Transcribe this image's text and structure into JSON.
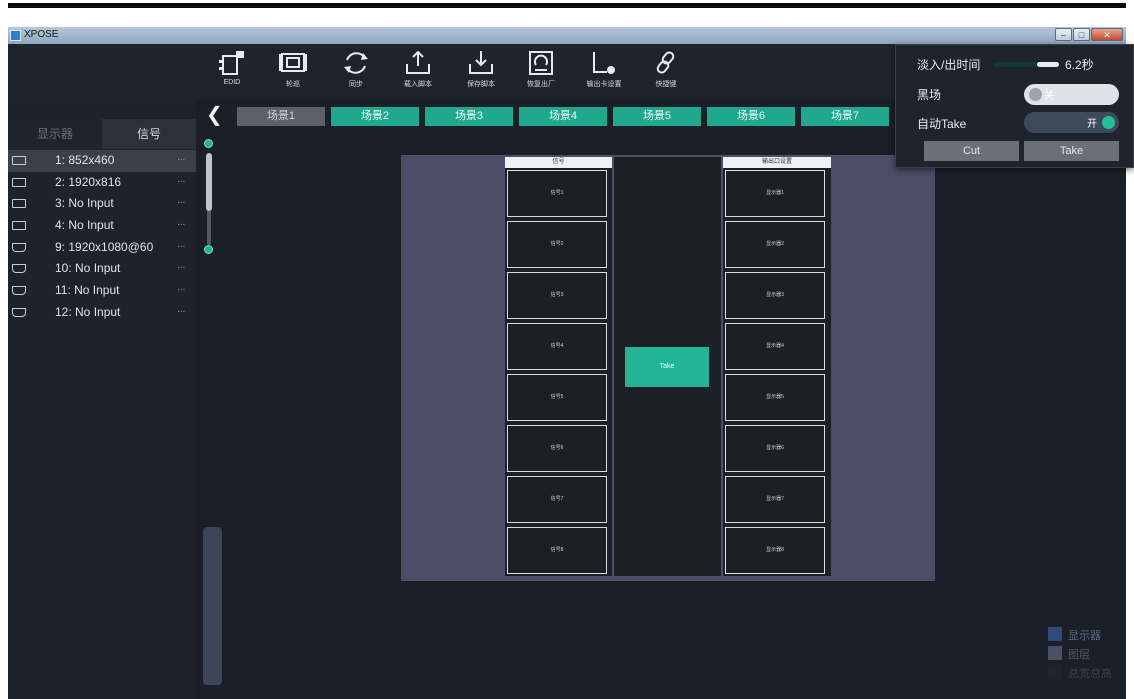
{
  "window": {
    "title": "XPOSE"
  },
  "left_panel": {
    "tabs": [
      {
        "label": "显示器"
      },
      {
        "label": "信号"
      }
    ],
    "signals": [
      {
        "label": "1: 852x460",
        "more": "...",
        "port": "dvi"
      },
      {
        "label": "2: 1920x816",
        "more": "...",
        "port": "dvi"
      },
      {
        "label": "3: No Input",
        "more": "...",
        "port": "dvi"
      },
      {
        "label": "4: No Input",
        "more": "...",
        "port": "dvi"
      },
      {
        "label": "9: 1920x1080@60",
        "more": "...",
        "port": "hdmi"
      },
      {
        "label": "10: No Input",
        "more": "...",
        "port": "hdmi"
      },
      {
        "label": "11: No Input",
        "more": "...",
        "port": "hdmi"
      },
      {
        "label": "12: No Input",
        "more": "...",
        "port": "hdmi"
      }
    ]
  },
  "toolbar": {
    "items": [
      {
        "label": "EDID",
        "icon": "edid-icon"
      },
      {
        "label": "轮巡",
        "icon": "poll-icon"
      },
      {
        "label": "同步",
        "icon": "sync-icon"
      },
      {
        "label": "载入脚本",
        "icon": "load-script-icon"
      },
      {
        "label": "保存脚本",
        "icon": "save-script-icon"
      },
      {
        "label": "恢复出厂",
        "icon": "factory-reset-icon"
      },
      {
        "label": "输出卡设置",
        "icon": "output-card-settings-icon"
      },
      {
        "label": "快捷键",
        "icon": "shortcut-link-icon"
      }
    ]
  },
  "scenes": [
    {
      "label": "场景1",
      "active": false
    },
    {
      "label": "场景2",
      "active": true
    },
    {
      "label": "场景3",
      "active": true
    },
    {
      "label": "场景4",
      "active": true
    },
    {
      "label": "场景5",
      "active": true
    },
    {
      "label": "场景6",
      "active": true
    },
    {
      "label": "场景7",
      "active": true
    }
  ],
  "stage": {
    "signal_header": "信号",
    "output_header": "输出口设置",
    "take_label": "Take",
    "signal_cells": [
      "信号1",
      "信号2",
      "信号3",
      "信号4",
      "信号5",
      "信号6",
      "信号7",
      "信号8"
    ],
    "output_cells": [
      "显示器1",
      "显示器2",
      "显示器3",
      "显示器4",
      "显示器5",
      "显示器6",
      "显示器7",
      "显示器8"
    ]
  },
  "popup": {
    "fade_label": "淡入/出时间",
    "fade_value": "6.2秒",
    "fade_level": 0.33,
    "black_label": "黑场",
    "black_toggle": "关",
    "auto_take_label": "自动Take",
    "auto_take_toggle": "开",
    "cut_label": "Cut",
    "take_label": "Take"
  },
  "legend": [
    {
      "label": "显示器",
      "color": "#2f4c78"
    },
    {
      "label": "图层",
      "color": "#4a4e67"
    },
    {
      "label": "总宽总高",
      "color": "#1f232b"
    }
  ],
  "colors": {
    "accent": "#1fa88e",
    "bg": "#1b1f27",
    "stage": "#4a4e67"
  }
}
